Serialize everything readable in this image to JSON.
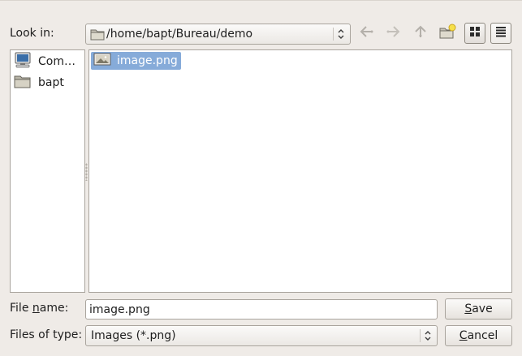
{
  "look_in": {
    "label": "Look in:",
    "path": "/home/bapt/Bureau/demo"
  },
  "toolbar": {
    "icons": [
      "back-icon",
      "forward-icon",
      "parent-directory-icon",
      "new-folder-icon",
      "icon-view-icon",
      "detail-view-icon"
    ],
    "active_view": "icon-view"
  },
  "sidebar": {
    "items": [
      {
        "label": "Com…",
        "icon": "computer-icon"
      },
      {
        "label": "bapt",
        "icon": "folder-icon"
      }
    ]
  },
  "files": [
    {
      "name": "image.png",
      "icon": "image-file-icon",
      "selected": true
    }
  ],
  "file_name": {
    "label": "File name:",
    "value": "image.png"
  },
  "file_type": {
    "label": "Files of type:",
    "value": "Images (*.png)"
  },
  "buttons": {
    "save": "Save",
    "cancel": "Cancel"
  },
  "colors": {
    "window_bg": "#efebe7",
    "selection": "#86abd9"
  }
}
